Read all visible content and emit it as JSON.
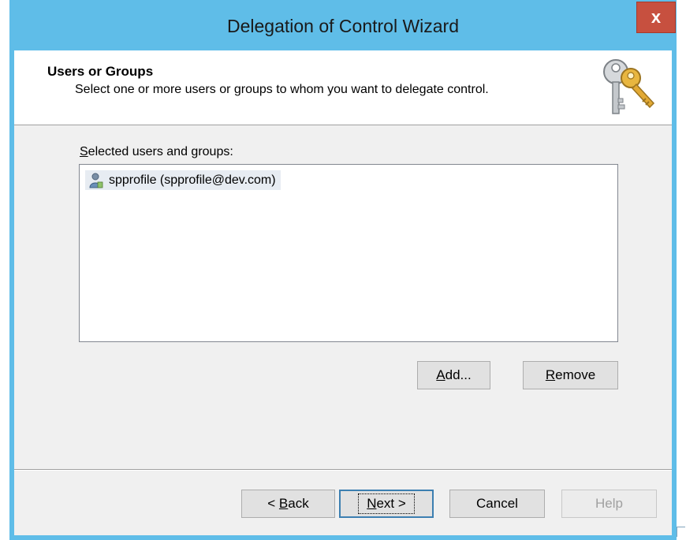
{
  "window": {
    "title": "Delegation of Control Wizard",
    "close_label": "x"
  },
  "header": {
    "title": "Users or Groups",
    "subtitle": "Select one or more users or groups to whom you want to delegate control."
  },
  "list": {
    "label_first": "S",
    "label_rest": "elected users and groups:",
    "items": [
      {
        "text": "spprofile (spprofile@dev.com)",
        "icon": "user-icon"
      }
    ]
  },
  "buttons": {
    "add": {
      "mnemonic": "A",
      "rest": "dd..."
    },
    "remove": {
      "mnemonic": "R",
      "rest": "emove"
    },
    "back": {
      "prefix": "< ",
      "mnemonic": "B",
      "rest": "ack"
    },
    "next": {
      "mnemonic": "N",
      "rest": "ext >"
    },
    "cancel": "Cancel",
    "help": "Help"
  },
  "colors": {
    "titlebar": "#5fbde8",
    "close": "#c7503f",
    "dialog_bg": "#f0f0f0",
    "default_button_border": "#3c7fb1"
  }
}
